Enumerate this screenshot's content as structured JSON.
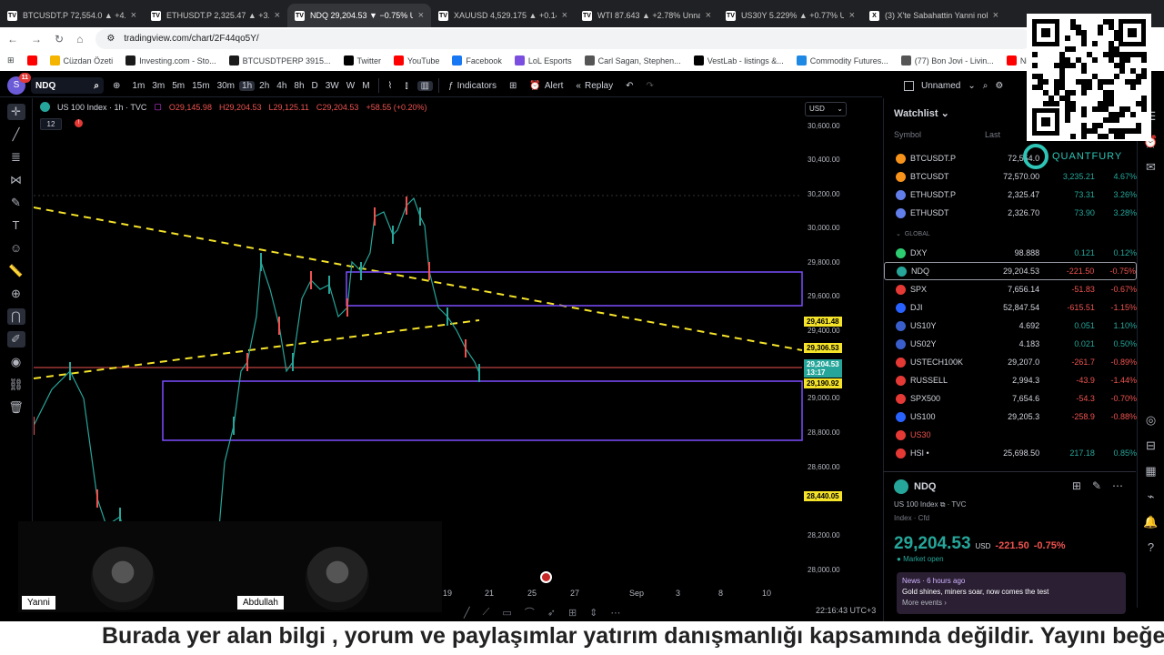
{
  "tabs": [
    {
      "icon": "tradingview-icon",
      "title": "BTCUSDT.P 72,554.0 ▲ +4.68%"
    },
    {
      "icon": "tradingview-icon",
      "title": "ETHUSDT.P 2,325.47 ▲ +3.26%"
    },
    {
      "icon": "tradingview-icon",
      "title": "NDQ 29,204.53 ▼ −0.75% Unn"
    },
    {
      "icon": "tradingview-icon",
      "title": "XAUUSD 4,529.175 ▲ +0.14%"
    },
    {
      "icon": "tradingview-icon",
      "title": "WTI 87.643 ▲ +2.78% Unname"
    },
    {
      "icon": "tradingview-icon",
      "title": "US30Y 5.229% ▲ +0.77% Unna"
    },
    {
      "icon": "x-icon",
      "title": "(3) X'te Sabahattin Yanni nokta"
    }
  ],
  "active_tab": 2,
  "url": "tradingview.com/chart/2F44qo5Y/",
  "bookmarks": [
    "",
    "Cüzdan Özeti",
    "Investing.com - Sto...",
    "BTCUSDTPERP 3915...",
    "Twitter",
    "YouTube",
    "Facebook",
    "LoL Esports",
    "Carl Sagan, Stephen...",
    "VestLab - listings &...",
    "Commodity Futures...",
    "(77) Bon Jovi - Livin...",
    "Nightcall - YouTube"
  ],
  "toolbar": {
    "avatar_initial": "S",
    "notif_count": "11",
    "symbol": "NDQ",
    "timeframes": [
      "1m",
      "3m",
      "5m",
      "15m",
      "30m",
      "1h",
      "2h",
      "4h",
      "8h",
      "D",
      "3W",
      "W",
      "M"
    ],
    "active_tf": "1h",
    "indicators": "Indicators",
    "alert": "Alert",
    "replay": "Replay",
    "layout_name": "Unnamed"
  },
  "legend": {
    "title": "US 100 Index · 1h · TVC",
    "o": "O29,145.98",
    "h": "H29,204.53",
    "l": "L29,125.11",
    "c": "C29,204.53",
    "chg": "+58.55 (+0.20%)",
    "interval": "12"
  },
  "currency": "USD",
  "price_axis": [
    "30,600.00",
    "30,400.00",
    "30,200.00",
    "30,000.00",
    "29,800.00",
    "29,600.00",
    "29,400.00",
    "29,000.00",
    "28,800.00",
    "28,600.00",
    "28,200.00",
    "28,000.00"
  ],
  "price_tags": [
    {
      "text": "29,461.48",
      "bg": "#f5e32a"
    },
    {
      "text": "29,306.53",
      "bg": "#f5e32a"
    },
    {
      "text": "29,204.53",
      "sub": "13:17",
      "bg": "#26a69a"
    },
    {
      "text": "29,190.92",
      "bg": "#f5e32a"
    },
    {
      "text": "28,440.05",
      "bg": "#f5e32a"
    }
  ],
  "time_axis": [
    "19",
    "21",
    "25",
    "27",
    "Sep",
    "3",
    "8",
    "10"
  ],
  "clock": "22:16:43 UTC+3",
  "watchlist": {
    "title": "Watchlist",
    "col_symbol": "Symbol",
    "col_last": "Last",
    "rows": [
      {
        "sym": "BTCUSDT.P",
        "last": "72,554.0",
        "chg": "",
        "pct": "",
        "icon": "#f7931a",
        "dir": "up"
      },
      {
        "sym": "BTCUSDT",
        "last": "72,570.00",
        "chg": "3,235.21",
        "pct": "4.67%",
        "icon": "#f7931a",
        "dir": "up"
      },
      {
        "sym": "ETHUSDT.P",
        "last": "2,325.47",
        "chg": "73.31",
        "pct": "3.26%",
        "icon": "#627eea",
        "dir": "up"
      },
      {
        "sym": "ETHUSDT",
        "last": "2,326.70",
        "chg": "73.90",
        "pct": "3.28%",
        "icon": "#627eea",
        "dir": "up"
      }
    ],
    "group": "GLOBAL",
    "rows2": [
      {
        "sym": "DXY",
        "last": "98.888",
        "chg": "0.121",
        "pct": "0.12%",
        "icon": "#2ecc71",
        "dir": "up"
      },
      {
        "sym": "NDQ",
        "last": "29,204.53",
        "chg": "-221.50",
        "pct": "-0.75%",
        "icon": "#26a69a",
        "dir": "dn"
      },
      {
        "sym": "SPX",
        "last": "7,656.14",
        "chg": "-51.83",
        "pct": "-0.67%",
        "icon": "#e53935",
        "dir": "dn"
      },
      {
        "sym": "DJI",
        "last": "52,847.54",
        "chg": "-615.51",
        "pct": "-1.15%",
        "icon": "#2962ff",
        "dir": "dn"
      },
      {
        "sym": "US10Y",
        "last": "4.692",
        "chg": "0.051",
        "pct": "1.10%",
        "icon": "#3a5fcd",
        "dir": "up"
      },
      {
        "sym": "US02Y",
        "last": "4.183",
        "chg": "0.021",
        "pct": "0.50%",
        "icon": "#3a5fcd",
        "dir": "up"
      },
      {
        "sym": "USTECH100K",
        "last": "29,207.0",
        "chg": "-261.7",
        "pct": "-0.89%",
        "icon": "#e53935",
        "dir": "dn"
      },
      {
        "sym": "RUSSELL",
        "last": "2,994.3",
        "chg": "-43.9",
        "pct": "-1.44%",
        "icon": "#e53935",
        "dir": "dn"
      },
      {
        "sym": "SPX500",
        "last": "7,654.6",
        "chg": "-54.3",
        "pct": "-0.70%",
        "icon": "#e53935",
        "dir": "dn"
      },
      {
        "sym": "US100",
        "last": "29,205.3",
        "chg": "-258.9",
        "pct": "-0.88%",
        "icon": "#2962ff",
        "dir": "dn"
      },
      {
        "sym": "US30",
        "last": "",
        "chg": "",
        "pct": "",
        "icon": "#e53935",
        "dir": "dn"
      },
      {
        "sym": "HSI •",
        "last": "25,698.50",
        "chg": "217.18",
        "pct": "0.85%",
        "icon": "#e53935",
        "dir": "up"
      }
    ]
  },
  "detail": {
    "sym": "NDQ",
    "name": "US 100 Index",
    "source": "TVC",
    "meta": "Index · Cfd",
    "price": "29,204.53",
    "cur": "USD",
    "chg": "-221.50",
    "pct": "-0.75%",
    "status": "Market open",
    "news_head": "News · 6 hours ago",
    "news_text": "Gold shines, miners soar, now comes the test",
    "more": "More events ›"
  },
  "quantfury": "QUANTFURY",
  "webcam": {
    "left": "Yanni",
    "right": "Abdullah"
  },
  "ticker": "Burada yer alan bilgi , yorum ve paylaşımlar yatırım danışmanlığı kapsamında değildir. Yayını beğe",
  "chart_data": {
    "type": "line",
    "title": "US 100 Index · 1h · TVC",
    "ylim": [
      28000,
      30600
    ]
  }
}
